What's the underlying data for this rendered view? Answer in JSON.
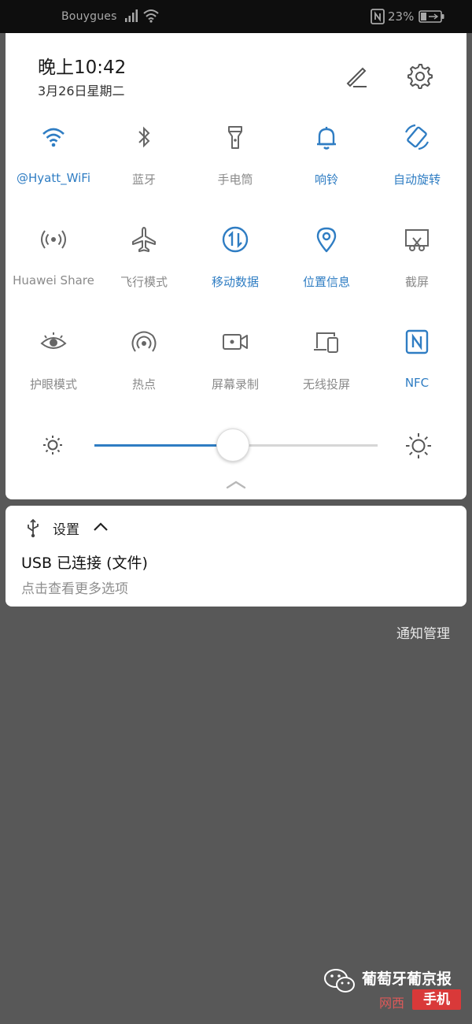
{
  "status_bar": {
    "carrier": "Bouygues",
    "battery": "23%",
    "icons": [
      "signal-icon",
      "wifi-icon",
      "nfc-icon",
      "battery-icon"
    ]
  },
  "header": {
    "time": "晚上10:42",
    "date": "3月26日星期二",
    "icons": [
      "edit-icon",
      "gear-icon"
    ]
  },
  "toggles": [
    {
      "label": "@Hyatt_WiFi",
      "icon": "wifi-icon",
      "active": true
    },
    {
      "label": "蓝牙",
      "icon": "bluetooth-icon",
      "active": false
    },
    {
      "label": "手电筒",
      "icon": "flashlight-icon",
      "active": false
    },
    {
      "label": "响铃",
      "icon": "bell-icon",
      "active": true
    },
    {
      "label": "自动旋转",
      "icon": "auto-rotate-icon",
      "active": true
    },
    {
      "label": "Huawei Share",
      "icon": "share-icon",
      "active": false
    },
    {
      "label": "飞行模式",
      "icon": "airplane-icon",
      "active": false
    },
    {
      "label": "移动数据",
      "icon": "mobile-data-icon",
      "active": true
    },
    {
      "label": "位置信息",
      "icon": "location-icon",
      "active": true
    },
    {
      "label": "截屏",
      "icon": "screenshot-icon",
      "active": false
    },
    {
      "label": "护眼模式",
      "icon": "eye-icon",
      "active": false
    },
    {
      "label": "热点",
      "icon": "hotspot-icon",
      "active": false
    },
    {
      "label": "屏幕录制",
      "icon": "screen-record-icon",
      "active": false
    },
    {
      "label": "无线投屏",
      "icon": "cast-icon",
      "active": false
    },
    {
      "label": "NFC",
      "icon": "nfc-icon",
      "active": true
    }
  ],
  "brightness": {
    "level": 0.49,
    "low_icon": "brightness-low-icon",
    "high_icon": "brightness-high-icon"
  },
  "colors": {
    "accent": "#2f7dc3",
    "inactive": "#8a8a8a",
    "background": "#585858"
  },
  "notification": {
    "app": "设置",
    "title": "USB 已连接 (文件)",
    "subtitle": "点击查看更多选项",
    "icon": "usb-icon"
  },
  "notification_manage": "通知管理",
  "watermark": {
    "text": "葡萄牙葡京报",
    "stamp_left": "网西",
    "stamp_right": "手机"
  }
}
